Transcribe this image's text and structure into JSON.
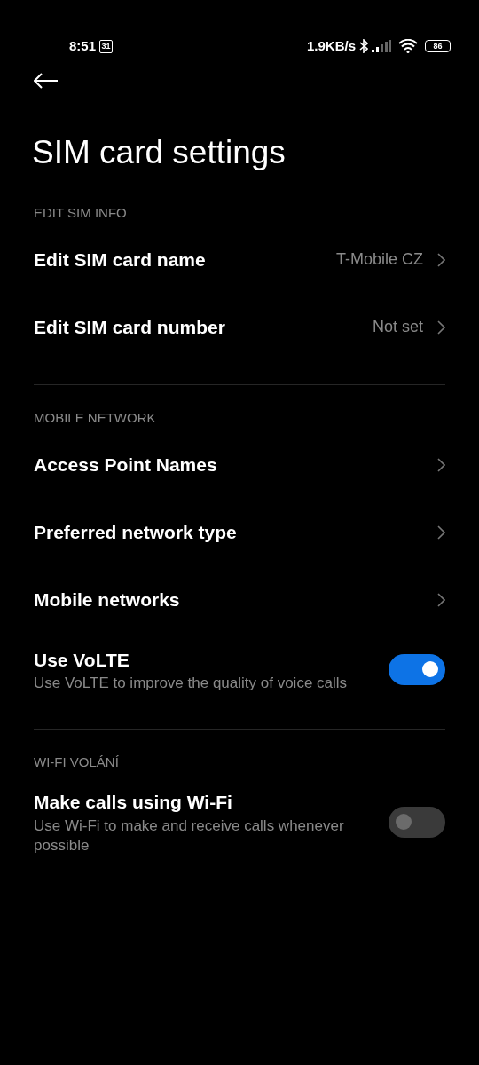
{
  "status_bar": {
    "time": "8:51",
    "calendar_day": "31",
    "speed": "1.9KB/s",
    "battery": "86"
  },
  "title": "SIM card settings",
  "sections": [
    {
      "header": "EDIT SIM INFO",
      "items": [
        {
          "kind": "link",
          "label": "Edit SIM card name",
          "value": "T-Mobile CZ"
        },
        {
          "kind": "link",
          "label": "Edit SIM card number",
          "value": "Not set"
        }
      ]
    },
    {
      "header": "MOBILE NETWORK",
      "items": [
        {
          "kind": "link",
          "label": "Access Point Names"
        },
        {
          "kind": "link",
          "label": "Preferred network type"
        },
        {
          "kind": "link",
          "label": "Mobile networks"
        },
        {
          "kind": "toggle",
          "label": "Use VoLTE",
          "description": "Use VoLTE to improve the quality of voice calls",
          "on": true
        }
      ]
    },
    {
      "header": "WI-FI VOLÁNÍ",
      "items": [
        {
          "kind": "toggle",
          "label": "Make calls using Wi-Fi",
          "description": "Use Wi-Fi to make and receive calls whenever possible",
          "on": false
        }
      ]
    }
  ]
}
